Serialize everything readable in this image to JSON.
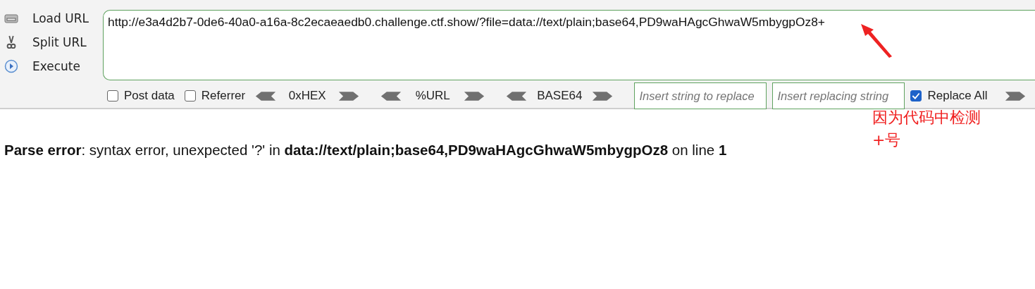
{
  "sidebar": {
    "items": [
      {
        "kind": "load",
        "label": "Load URL"
      },
      {
        "kind": "split",
        "label": "Split URL"
      },
      {
        "kind": "execute",
        "label": "Execute"
      }
    ]
  },
  "url_field": {
    "value": "http://e3a4d2b7-0de6-40a0-a16a-8c2ecaeaedb0.challenge.ctf.show/?file=data://text/plain;base64,PD9waHAgcGhwaW5mbygpOz8+"
  },
  "options": [
    {
      "label": "Post data",
      "checked": false
    },
    {
      "label": "Referrer",
      "checked": false
    }
  ],
  "encoders": [
    "0xHEX",
    "%URL",
    "BASE64"
  ],
  "replace": {
    "find_placeholder": "Insert string to replace",
    "replace_placeholder": "Insert replacing string",
    "replace_all": {
      "label": "Replace All",
      "checked": true
    }
  },
  "error_message": "**Parse error**: syntax error, unexpected '?' in **data://text/plain;base64,PD9waHAgcGhwaW5mbygpOz8** on line **1**",
  "annotation": {
    "lines": [
      "因为代码中检测",
      "+号"
    ]
  }
}
